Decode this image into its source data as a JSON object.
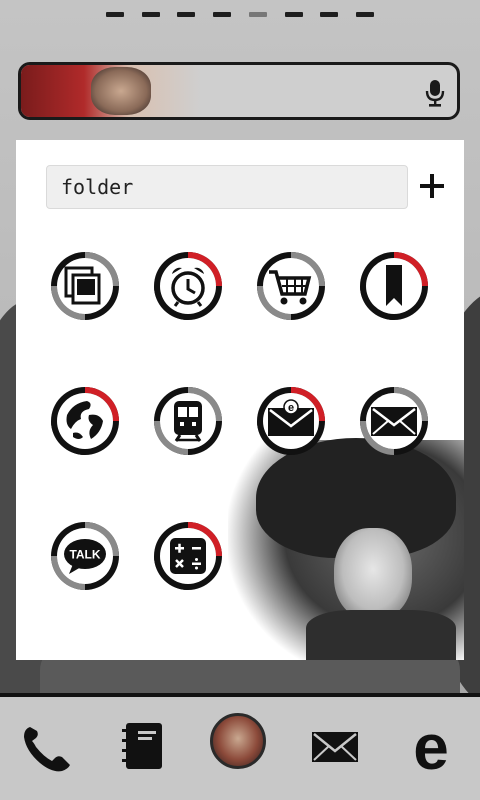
{
  "folder": {
    "name": "folder",
    "add_icon": "plus-icon",
    "apps": [
      {
        "icon": "gallery-icon",
        "ring": "gray"
      },
      {
        "icon": "alarm-clock-icon",
        "ring": "red"
      },
      {
        "icon": "shopping-cart-icon",
        "ring": "gray"
      },
      {
        "icon": "bookmark-icon",
        "ring": "red"
      },
      {
        "icon": "globe-icon",
        "ring": "red"
      },
      {
        "icon": "train-icon",
        "ring": "gray"
      },
      {
        "icon": "email-icon",
        "ring": "red"
      },
      {
        "icon": "mail-icon",
        "ring": "gray"
      },
      {
        "icon": "talk-icon",
        "ring": "gray",
        "label": "TALK"
      },
      {
        "icon": "calculator-icon",
        "ring": "red"
      }
    ]
  },
  "search": {
    "mic_icon": "microphone-icon"
  },
  "page_indicator": {
    "count": 8,
    "active_index": 4
  },
  "dock": {
    "items": [
      {
        "icon": "phone-icon"
      },
      {
        "icon": "contacts-icon"
      },
      {
        "icon": "avatar"
      },
      {
        "icon": "mail-icon"
      },
      {
        "icon": "browser-e-icon",
        "label": "e"
      }
    ]
  },
  "colors": {
    "accent": "#d01f26",
    "ring_gray": "#8a8a8a",
    "dark": "#111111"
  }
}
